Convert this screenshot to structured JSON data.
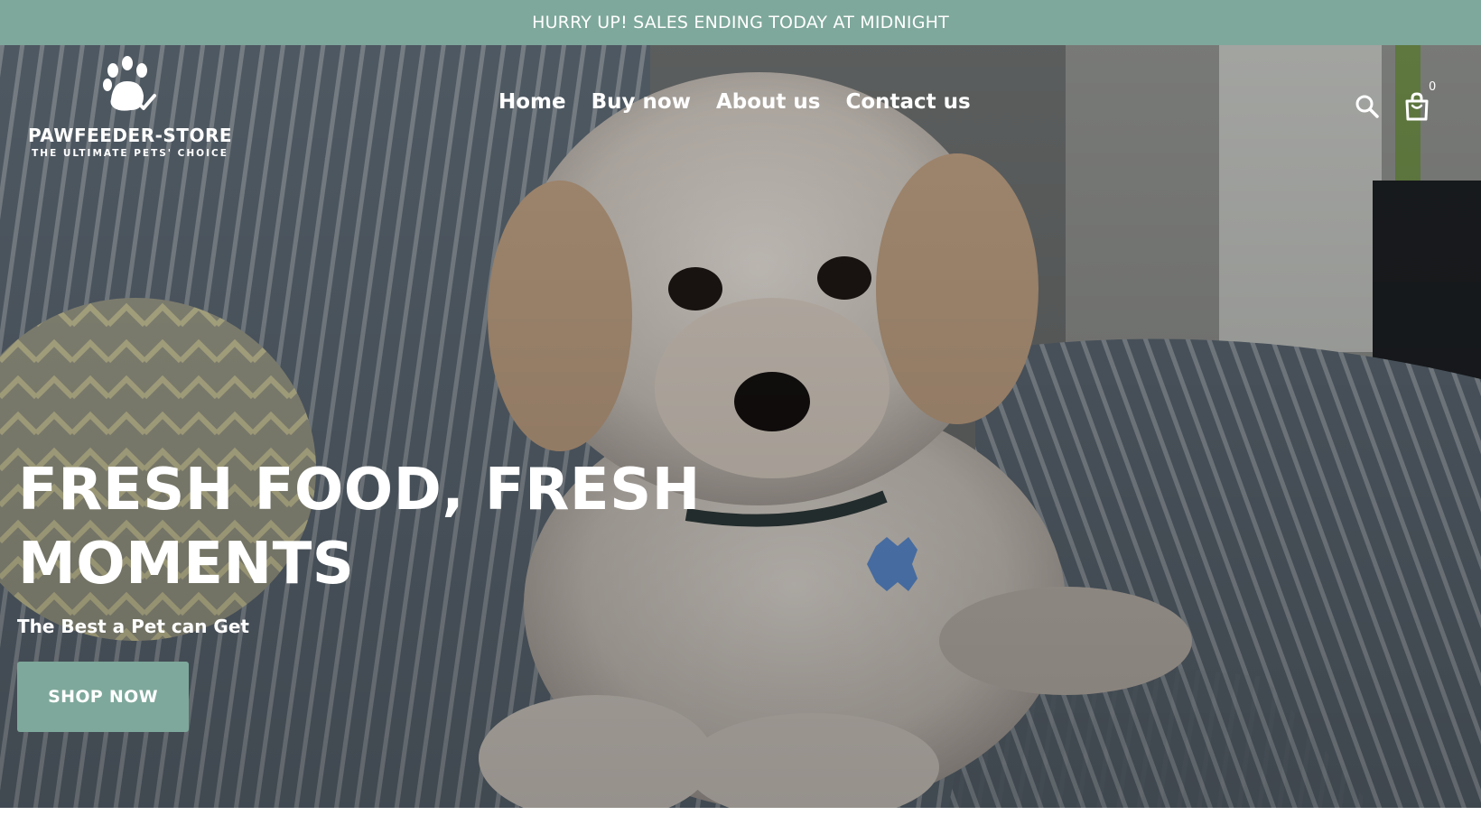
{
  "announcement": {
    "text": "HURRY UP! SALES ENDING TODAY AT MIDNIGHT",
    "background": "#7ea89b"
  },
  "header": {
    "logo": {
      "name": "PAWFEEDER-STORE",
      "tagline": "THE ULTIMATE PETS' CHOICE",
      "icon": "paw-check-icon"
    },
    "nav": [
      {
        "label": "Home"
      },
      {
        "label": "Buy now"
      },
      {
        "label": "About us"
      },
      {
        "label": "Contact us"
      }
    ],
    "search_icon": "search-icon",
    "cart": {
      "icon": "shopping-bag-icon",
      "count": "0"
    }
  },
  "hero": {
    "headline_line1": "FRESH FOOD, FRESH",
    "headline_line2": "MOMENTS",
    "subheading": "The Best a Pet can Get",
    "cta_label": "SHOP NOW",
    "accent_color": "#7ea89b"
  }
}
